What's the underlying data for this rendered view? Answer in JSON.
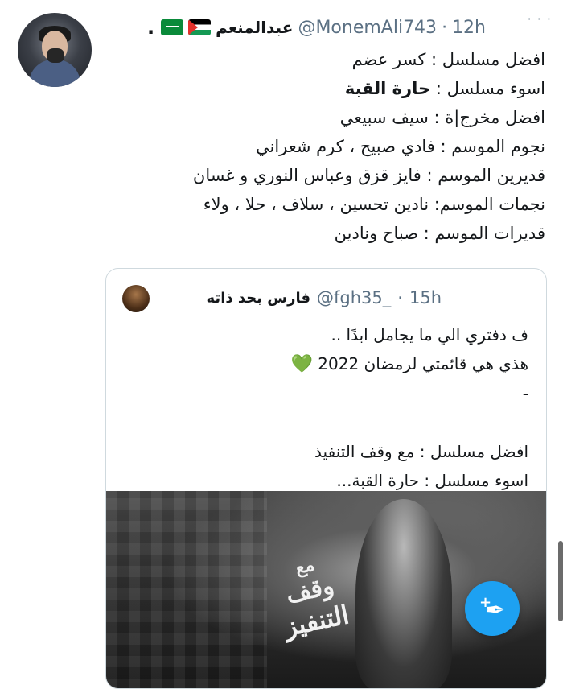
{
  "tweet": {
    "author_name": "عبدالمنعم",
    "handle": "@MonemAli743",
    "separator": "·",
    "time": "12h",
    "name_dot": ".",
    "more_icon": "more-icon",
    "lines": [
      "افضل مسلسل : كسر عضم",
      "اسوء مسلسل :",
      "افضل مخرج|ة : سيف سبيعي",
      "نجوم الموسم : فادي صبيح ، كرم شعراني",
      "قديرين الموسم : فايز قزق وعباس النوري و غسان",
      "نجمات الموسم: نادين تحسين ، سلاف ، حلا ، ولاء",
      "قديرات الموسم : صباح ونادين"
    ],
    "bold_worst": "حارة القبة"
  },
  "quote": {
    "author_name": "فارس بحد ذاته",
    "handle": "@fgh35_",
    "separator": "·",
    "time": "15h",
    "lines": [
      "ف دفتري الي ما يجامل ابدًا ..",
      "هذي هي قائمتي لرمضان 2022",
      "-",
      "",
      "افضل مسلسل : مع وقف التنفيذ",
      "اسوء مسلسل : حارة القبة..."
    ],
    "heart": "💚",
    "image_text": [
      "مع",
      "وقف",
      "التنفيز"
    ]
  },
  "fab": {
    "icon": "compose-icon",
    "plus": "+",
    "color": "#1da1f2"
  }
}
